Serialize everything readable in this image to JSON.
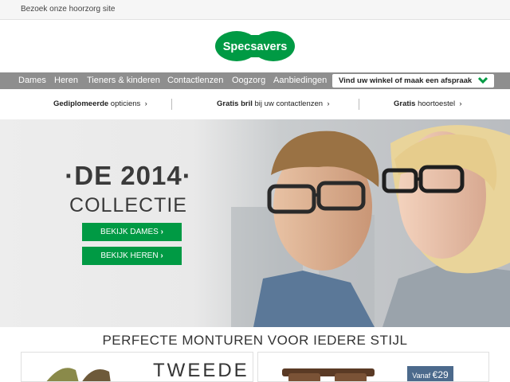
{
  "topbar": {
    "link": "Bezoek onze hoorzorg site"
  },
  "logo": {
    "text": "Specsavers"
  },
  "nav": {
    "items": [
      "Dames",
      "Heren",
      "Tieners & kinderen",
      "Contactlenzen",
      "Oogzorg",
      "Aanbiedingen"
    ],
    "store_button": "Vind uw winkel of maak een afspraak"
  },
  "usp": [
    {
      "bold": "Gediplomeerde",
      "text": " opticiens"
    },
    {
      "bold": "Gratis bril",
      "text": " bij uw contactlenzen"
    },
    {
      "bold": "Gratis",
      "text": " hoortoestel"
    }
  ],
  "hero": {
    "title": "DE 2014",
    "subtitle": "COLLECTIE",
    "cta_women": "BEKIJK DAMES",
    "cta_men": "BEKIJK HEREN"
  },
  "section": {
    "title": "PERFECTE MONTUREN VOOR IEDERE STIJL"
  },
  "cards": {
    "left_text": "TWEEDE",
    "price_prefix": "Vanaf",
    "price": "€29"
  },
  "colors": {
    "brand_green": "#009a44",
    "nav_grey": "#8e8e8e",
    "price_blue": "#4c6a8c"
  }
}
